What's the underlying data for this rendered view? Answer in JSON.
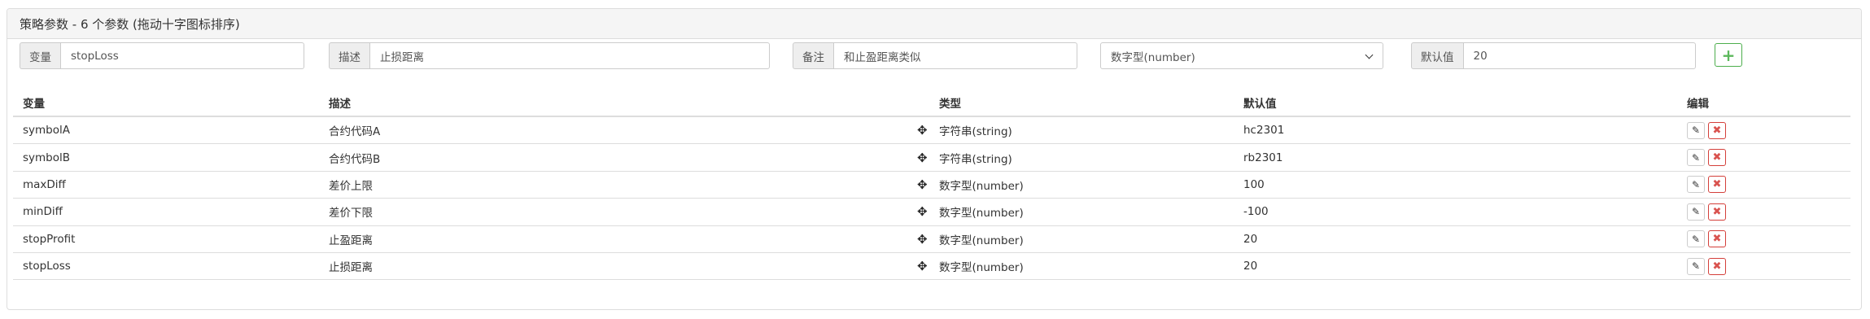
{
  "panel": {
    "title": "策略参数 - 6 个参数 (拖动十字图标排序)"
  },
  "form": {
    "var_label": "变量",
    "var_value": "stopLoss",
    "desc_label": "描述",
    "desc_value": "止损距离",
    "note_label": "备注",
    "note_value": "和止盈距离类似",
    "type_selected": "数字型(number)",
    "default_label": "默认值",
    "default_value": "20",
    "add_label": "+"
  },
  "table": {
    "headers": {
      "var": "变量",
      "desc": "描述",
      "type": "类型",
      "default": "默认值",
      "edit": "编辑"
    },
    "move_icon": "✥",
    "edit_icon": "✎",
    "delete_icon": "✖",
    "rows": [
      {
        "var": "symbolA",
        "desc": "合约代码A",
        "type": "字符串(string)",
        "default": "hc2301"
      },
      {
        "var": "symbolB",
        "desc": "合约代码B",
        "type": "字符串(string)",
        "default": "rb2301"
      },
      {
        "var": "maxDiff",
        "desc": "差价上限",
        "type": "数字型(number)",
        "default": "100"
      },
      {
        "var": "minDiff",
        "desc": "差价下限",
        "type": "数字型(number)",
        "default": "-100"
      },
      {
        "var": "stopProfit",
        "desc": "止盈距离",
        "type": "数字型(number)",
        "default": "20"
      },
      {
        "var": "stopLoss",
        "desc": "止损距离",
        "type": "数字型(number)",
        "default": "20"
      }
    ]
  },
  "colors": {
    "add_green": "#5cb85c",
    "delete_red": "#d9534f",
    "heading_bg": "#f5f5f5"
  }
}
